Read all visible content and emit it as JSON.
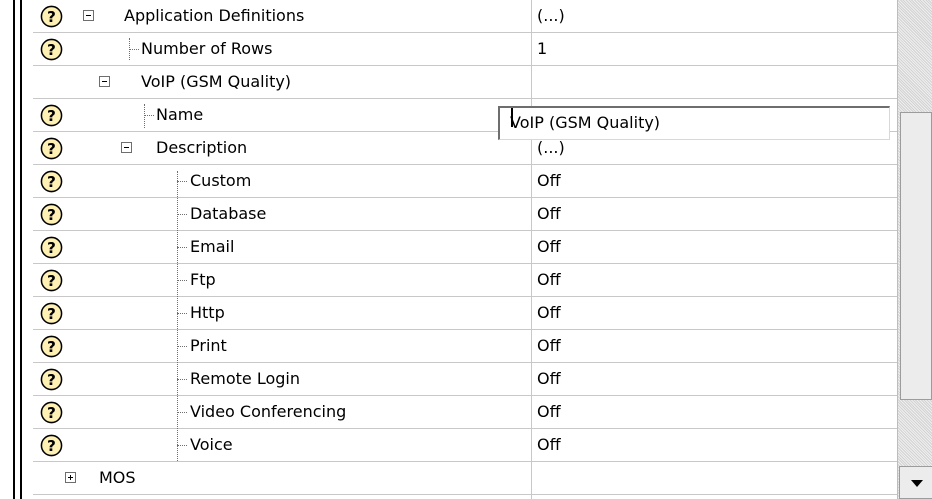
{
  "grid": {
    "rows": [
      {
        "label": "Application Definitions",
        "value": "(...)",
        "help": true,
        "toggle": "minus"
      },
      {
        "label": "Number of Rows",
        "value": "1",
        "help": true
      },
      {
        "label": "VoIP (GSM Quality)",
        "value": "",
        "help": false,
        "toggle": "minus"
      },
      {
        "label": "Name",
        "value": "",
        "help": true
      },
      {
        "label": "Description",
        "value": "(...)",
        "help": true,
        "toggle": "minus"
      },
      {
        "label": "Custom",
        "value": "Off",
        "help": true
      },
      {
        "label": "Database",
        "value": "Off",
        "help": true
      },
      {
        "label": "Email",
        "value": "Off",
        "help": true
      },
      {
        "label": "Ftp",
        "value": "Off",
        "help": true
      },
      {
        "label": "Http",
        "value": "Off",
        "help": true
      },
      {
        "label": "Print",
        "value": "Off",
        "help": true
      },
      {
        "label": "Remote Login",
        "value": "Off",
        "help": true
      },
      {
        "label": "Video Conferencing",
        "value": "Off",
        "help": true
      },
      {
        "label": "Voice",
        "value": "Off",
        "help": true
      },
      {
        "label": "MOS",
        "value": "",
        "help": false,
        "toggle": "plus"
      }
    ],
    "edit_value": "VoIP (GSM Quality)",
    "help_icon": "question-mark-circle-icon"
  },
  "colors": {
    "help_icon_fill": "#fff0b4",
    "border": "#6e6e6e",
    "gridline": "#c8c8c8"
  }
}
